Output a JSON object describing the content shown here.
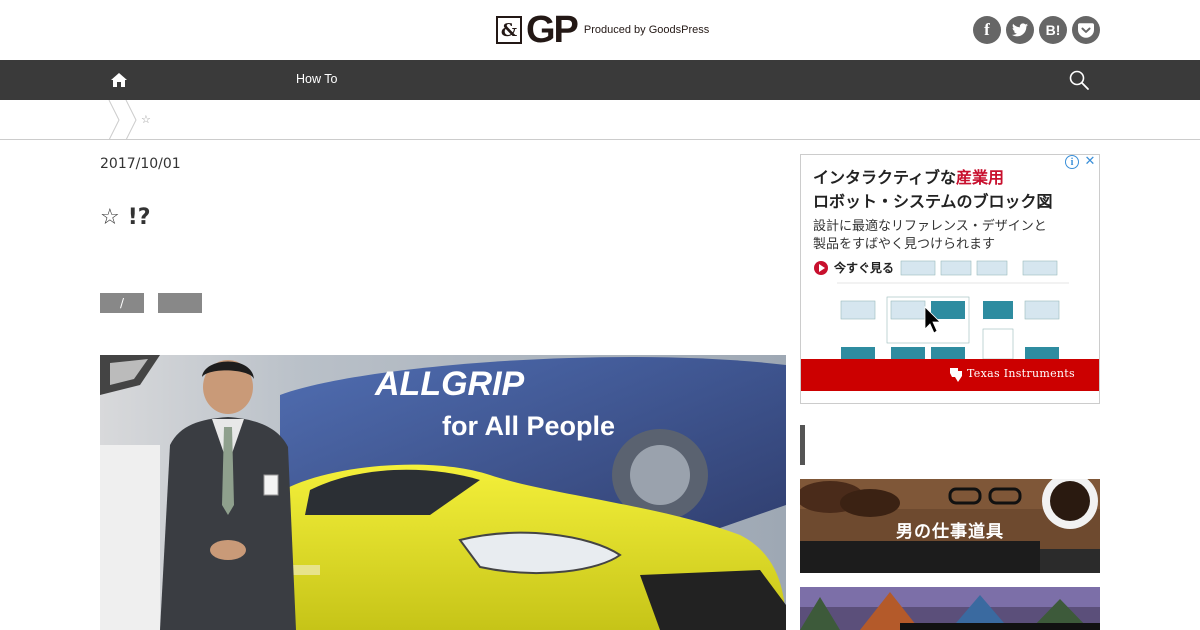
{
  "header": {
    "logo_amp": "&",
    "logo_gp": "GP",
    "logo_tagline": "Produced by GoodsPress",
    "social": [
      {
        "name": "facebook",
        "label": "f"
      },
      {
        "name": "twitter",
        "label": ""
      },
      {
        "name": "hatena",
        "label": "B!"
      },
      {
        "name": "pocket",
        "label": ""
      }
    ]
  },
  "nav": {
    "home_icon": "home-icon",
    "howto_label": "How To",
    "search_icon": "search-icon"
  },
  "breadcrumb": {
    "star": "☆"
  },
  "article": {
    "date": "2017/10/01",
    "title_star": "☆",
    "title_text": "!?",
    "tags": [
      "/",
      ""
    ],
    "hero_text_line1": "ALLGRIP",
    "hero_text_line2": "for All People"
  },
  "ad": {
    "title1_prefix": "インタラクティブな",
    "title1_highlight": "産業用",
    "title2": "ロボット・システムのブロック図",
    "body1": "設計に最適なリファレンス・デザインと",
    "body2": "製品をすばやく見つけられます",
    "cta": "今すぐ見る",
    "brand": "Texas Instruments",
    "info": "i",
    "close": "✕",
    "accent": "#cc0000"
  },
  "sidebar": {
    "banner1_text": "男の仕事道具"
  }
}
